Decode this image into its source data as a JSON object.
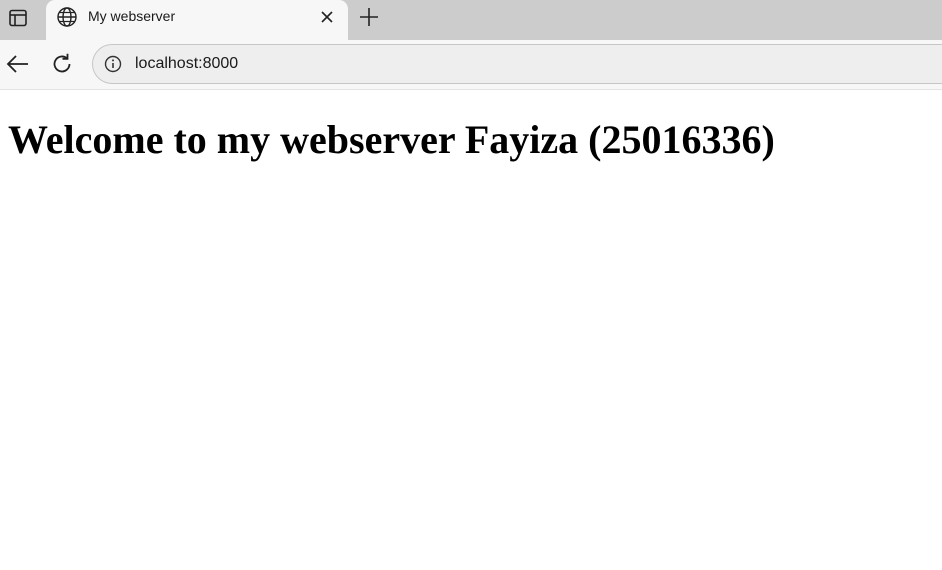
{
  "browser": {
    "tab": {
      "title": "My webserver",
      "favicon": "globe-icon"
    },
    "address_bar": {
      "url": "localhost:8000",
      "site_info_icon": "info-icon"
    },
    "icons": {
      "tab_actions": "tab-actions-icon",
      "close": "close-icon",
      "new_tab": "plus-icon",
      "back": "back-arrow-icon",
      "reload": "reload-icon"
    },
    "colors": {
      "tabstrip": "#cccccc",
      "active_tab": "#f7f7f7",
      "omnibox": "#eeeeee"
    }
  },
  "page": {
    "heading": "Welcome to my webserver Fayiza (25016336)"
  }
}
